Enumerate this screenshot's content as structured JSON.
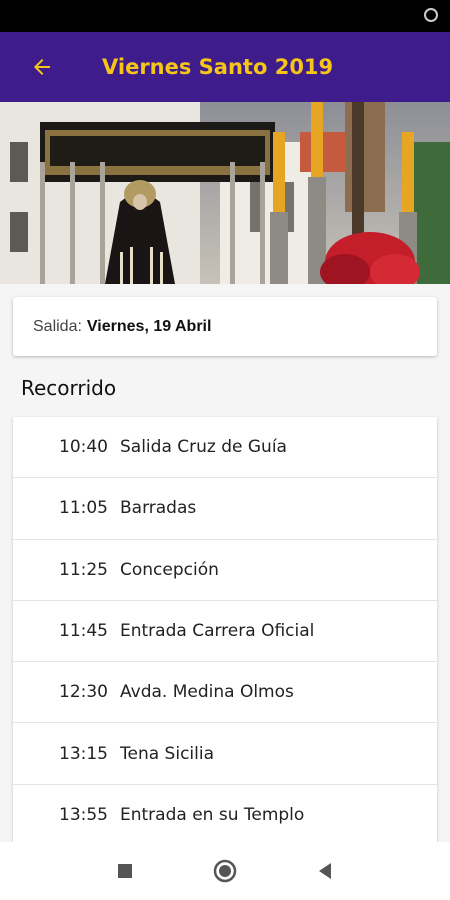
{
  "app_bar": {
    "title": "Viernes Santo 2019",
    "back_icon": "arrow-left-icon",
    "background_color": "#3f1c8c",
    "title_color": "#f5c518"
  },
  "departure": {
    "label": "Salida:",
    "value": "Viernes, 19 Abril"
  },
  "route": {
    "title": "Recorrido",
    "items": [
      {
        "time": "10:40",
        "place": "Salida Cruz de Guía"
      },
      {
        "time": "11:05",
        "place": "Barradas"
      },
      {
        "time": "11:25",
        "place": "Concepción"
      },
      {
        "time": "11:45",
        "place": "Entrada Carrera Oficial"
      },
      {
        "time": "12:30",
        "place": "Avda. Medina Olmos"
      },
      {
        "time": "13:15",
        "place": "Tena Sicilia"
      },
      {
        "time": "13:55",
        "place": "Entrada en su Templo"
      }
    ]
  },
  "nav_bar": {
    "icons": [
      "square-recents-icon",
      "circle-home-icon",
      "triangle-back-icon"
    ]
  }
}
